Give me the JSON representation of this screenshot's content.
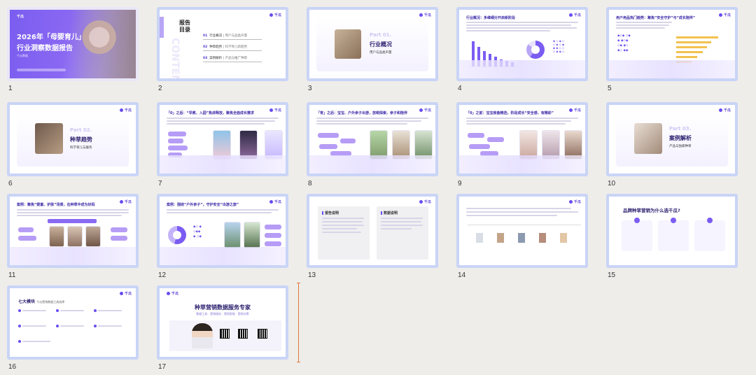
{
  "slides": [
    {
      "number": "1",
      "title_line1": "2026年「母婴育儿」",
      "title_line2": "行业洞察数据报告",
      "brand": "千瓜",
      "subtitle": "千瓜数据"
    },
    {
      "number": "2",
      "toc_title_1": "报告",
      "toc_title_2": "目录",
      "watermark": "CONTENTS",
      "items": [
        {
          "no": "01",
          "label": "行业概况",
          "desc": "| 用户与品类声量"
        },
        {
          "no": "02",
          "label": "种草趋势",
          "desc": "| 科学育儿新趋势"
        },
        {
          "no": "03",
          "label": "案例解析",
          "desc": "| 产品与推广种草"
        }
      ]
    },
    {
      "number": "3",
      "part": "Part 01.",
      "title": "行业概况",
      "sub": "用户与品类声量"
    },
    {
      "number": "4",
      "heading": "行业概况：多维细分开启新阶段"
    },
    {
      "number": "5",
      "heading": "用户用品热门趋势：聚焦“安全守护”与“成长陪伴”"
    },
    {
      "number": "6",
      "part": "Part 02.",
      "title": "种草趋势",
      "sub": "科学育儿与服务"
    },
    {
      "number": "7",
      "heading": "「0」之后：“早教、入园”焦虑释放，聚焦全面成长需求"
    },
    {
      "number": "8",
      "heading": "「育」之后：宝宝、户外亲子出游，放眼探索，亲子和陪伴"
    },
    {
      "number": "9",
      "heading": "「0」之前：宝宝装备精选，阶段成长“安全感、有精彩”"
    },
    {
      "number": "10",
      "part": "Part 03.",
      "title": "案例解析",
      "sub": "产品与独家种草"
    },
    {
      "number": "11",
      "heading": "案例：聚焦“婴童、护肤”场景，在种草中成为好妈"
    },
    {
      "number": "12",
      "heading": "案例：围绕“户外亲子”，守护安全“出游之旅”"
    },
    {
      "number": "13",
      "box1": "报告说明",
      "box2": "数据说明"
    },
    {
      "number": "14",
      "heading": ""
    },
    {
      "number": "15",
      "heading": "品牌种草营销为什么选千瓜?"
    },
    {
      "number": "16",
      "heading": "七大模块",
      "sub": "千瓜营销数据工具选择"
    },
    {
      "number": "17",
      "heading": "种草营销数据服务专家",
      "sub": "数据工具 · 营销服务 · 营销智能 · 营销决策"
    }
  ],
  "brand_logo": "千瓜",
  "colors": {
    "accent": "#6a4cf0",
    "thumb_border": "#c9d4f6",
    "background": "#eeedea"
  }
}
